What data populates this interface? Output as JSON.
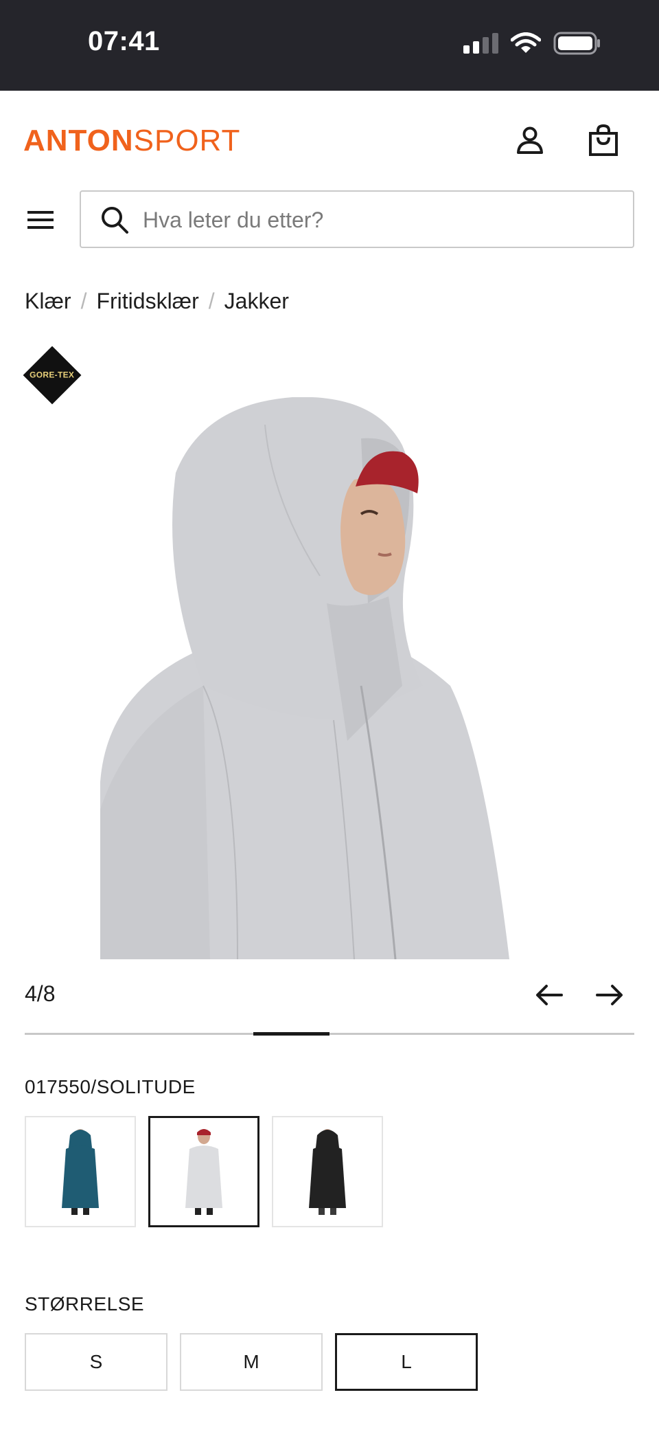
{
  "status_bar": {
    "time": "07:41"
  },
  "header": {
    "logo_part1": "ANTON",
    "logo_part2": "SPORT",
    "account_icon": "user-icon",
    "cart_icon": "shopping-bag-icon"
  },
  "search": {
    "placeholder": "Hva leter du etter?",
    "value": ""
  },
  "breadcrumb": [
    "Klær",
    "Fritidsklær",
    "Jakker"
  ],
  "product": {
    "badge": "GORE-TEX",
    "image_counter": "4/8",
    "current_image": 4,
    "total_images": 8,
    "variant_code": "017550/SOLITUDE",
    "colors": [
      {
        "name": "blue",
        "hex": "#1f5c73",
        "selected": false
      },
      {
        "name": "solitude",
        "hex": "#dcdde0",
        "selected": true
      },
      {
        "name": "black",
        "hex": "#222222",
        "selected": false
      }
    ],
    "size_label": "STØRRELSE",
    "sizes": [
      {
        "label": "S",
        "selected": false
      },
      {
        "label": "M",
        "selected": false
      },
      {
        "label": "L",
        "selected": true
      }
    ]
  },
  "colors": {
    "brand": "#f0621c",
    "statusbar": "#25252b",
    "text": "#1a1a1a"
  }
}
